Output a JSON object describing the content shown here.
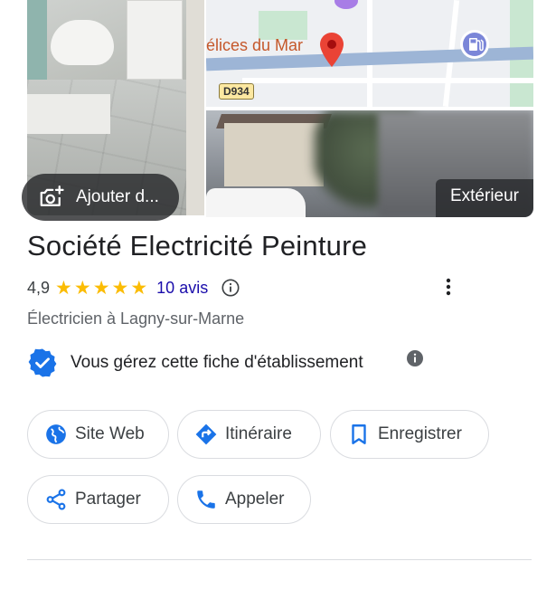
{
  "photos": {
    "add_photo_label": "Ajouter d...",
    "street_label": "Extérieur",
    "map_place_label": "élices du Mar",
    "map_road_shield": "D934"
  },
  "business": {
    "name": "Société Electricité Peinture",
    "rating": "4,9",
    "rating_stars": 5,
    "reviews_link": "10 avis",
    "category": "Électricien à Lagny-sur-Marne",
    "verified_text": "Vous gérez cette fiche d'établissement"
  },
  "actions": {
    "website": "Site Web",
    "directions": "Itinéraire",
    "save": "Enregistrer",
    "share": "Partager",
    "call": "Appeler"
  },
  "icons": {
    "add_photo": "add-photo-icon",
    "star": "star-icon",
    "info": "info-icon",
    "more": "more-vert-icon",
    "verified": "verified-badge-icon",
    "globe": "globe-icon",
    "directions": "directions-icon",
    "bookmark": "bookmark-icon",
    "share": "share-icon",
    "phone": "phone-icon"
  },
  "colors": {
    "accent_blue": "#1a73e8",
    "link": "#1a0dab",
    "star": "#fbbc04",
    "map_pin": "#ea4335",
    "border": "#dadce0"
  }
}
